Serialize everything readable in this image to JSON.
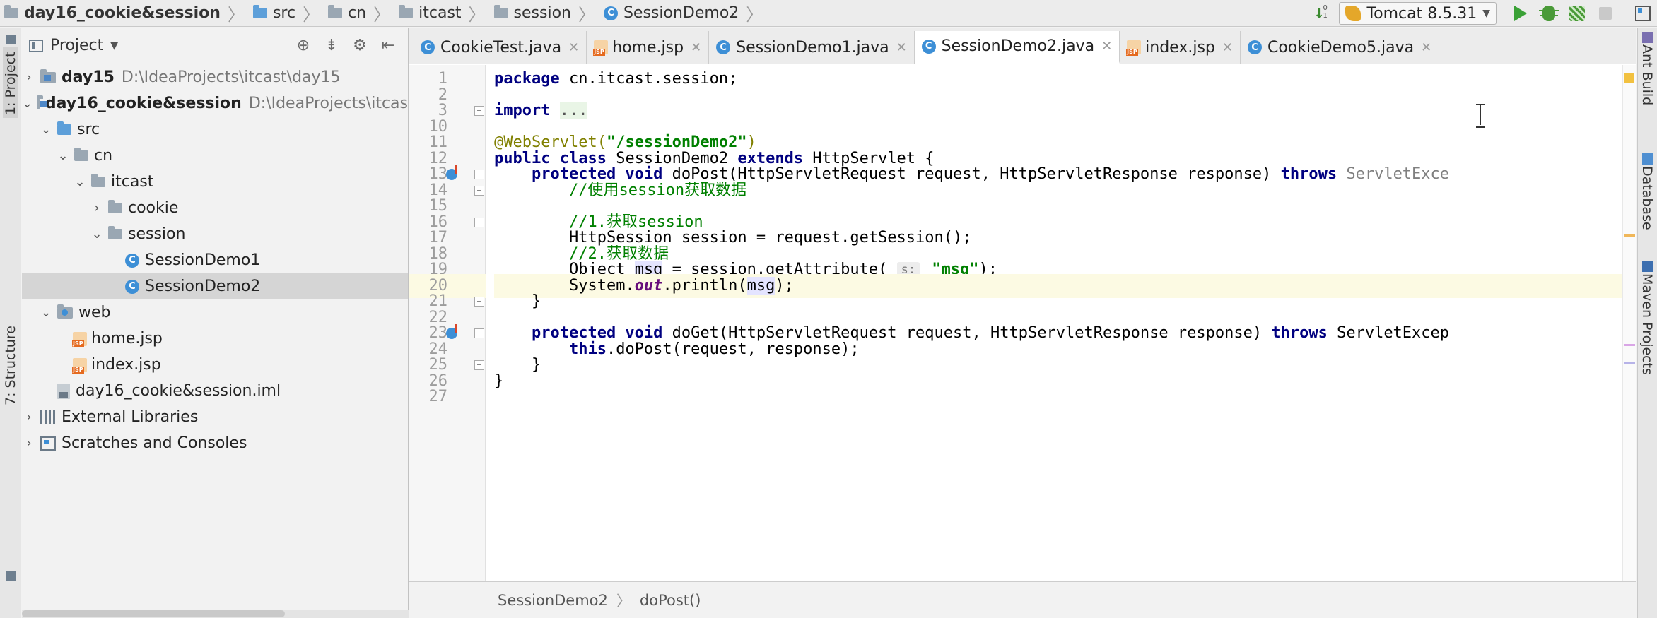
{
  "breadcrumbs": {
    "project": "day16_cookie&session",
    "items": [
      "src",
      "cn",
      "itcast",
      "session",
      "SessionDemo2"
    ]
  },
  "toolbar": {
    "sort_numbers": "0\n1",
    "run_config": "Tomcat 8.5.31"
  },
  "left_stripe": {
    "project_tab": "1: Project",
    "structure_tab": "7: Structure"
  },
  "project_panel": {
    "title": "Project",
    "tree": [
      {
        "label": "day15",
        "path": "D:\\IdeaProjects\\itcast\\day15"
      },
      {
        "label": "day16_cookie&session",
        "path": "D:\\IdeaProjects\\itcas"
      },
      {
        "label": "src"
      },
      {
        "label": "cn"
      },
      {
        "label": "itcast"
      },
      {
        "label": "cookie"
      },
      {
        "label": "session"
      },
      {
        "label": "SessionDemo1"
      },
      {
        "label": "SessionDemo2"
      },
      {
        "label": "web"
      },
      {
        "label": "home.jsp"
      },
      {
        "label": "index.jsp"
      },
      {
        "label": "day16_cookie&session.iml"
      },
      {
        "label": "External Libraries"
      },
      {
        "label": "Scratches and Consoles"
      }
    ]
  },
  "editor": {
    "tabs": [
      {
        "label": "CookieTest.java"
      },
      {
        "label": "home.jsp"
      },
      {
        "label": "SessionDemo1.java"
      },
      {
        "label": "SessionDemo2.java"
      },
      {
        "label": "index.jsp"
      },
      {
        "label": "CookieDemo5.java"
      }
    ],
    "active_tab": "SessionDemo2.java",
    "line_numbers": [
      "1",
      "2",
      "3",
      "10",
      "11",
      "12",
      "13",
      "14",
      "15",
      "16",
      "17",
      "18",
      "19",
      "20",
      "21",
      "22",
      "23",
      "24",
      "25",
      "26",
      "27"
    ],
    "code": {
      "l1_kw": "package",
      "l1_rest": " cn.itcast.session;",
      "l3_kw": "import",
      "l3_fold": "...",
      "l11_ann": "@WebServlet(",
      "l11_str": "\"/sessionDemo2\"",
      "l11_end": ")",
      "l12_kw1": "public class",
      "l12_name": " SessionDemo2 ",
      "l12_kw2": "extends",
      "l12_rest": " HttpServlet {",
      "l13_kw": "protected void",
      "l13_sig": " doPost(HttpServletRequest request, HttpServletResponse response) ",
      "l13_throws": "throws",
      "l13_exc": " ServletExce",
      "l14_comment": "//使用session获取数据",
      "l16_comment": "//1.获取session",
      "l17_code": "HttpSession session = request.getSession();",
      "l18_comment": "//2.获取数据",
      "l19_pre": "Object ",
      "l19_var": "msg",
      "l19_mid": " = session.getAttribute( ",
      "l19_hint": "s:",
      "l19_str": " \"msg\"",
      "l19_end": ");",
      "l20_pre": "System.",
      "l20_field": "out",
      "l20_mid": ".println(",
      "l20_var": "msg",
      "l20_end": ");",
      "l21": "}",
      "l23_kw": "protected void",
      "l23_sig": " doGet(HttpServletRequest request, HttpServletResponse response) ",
      "l23_throws": "throws",
      "l23_exc": " ServletExcep",
      "l24_kw": "this",
      "l24_rest": ".doPost(request, response);",
      "l25": "}",
      "l26": "}"
    },
    "bottom_breadcrumb": [
      "SessionDemo2",
      "doPost()"
    ]
  },
  "right_stripe": {
    "tabs": [
      "Ant Build",
      "Database",
      "Maven Projects"
    ]
  },
  "colors": {
    "keyword": "#000080",
    "string": "#008000",
    "annotation": "#808000",
    "comment": "#808080",
    "current_line": "#fcfae3"
  }
}
